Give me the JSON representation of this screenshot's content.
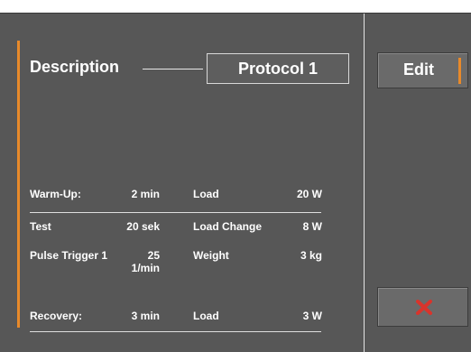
{
  "description": {
    "label": "Description",
    "protocol": "Protocol 1"
  },
  "rows": [
    {
      "label": "Warm-Up:",
      "value": "2 min",
      "param": "Load",
      "param_value": "20 W"
    },
    {
      "label": "Test",
      "value": "20 sek",
      "param": "Load Change",
      "param_value": "8 W"
    },
    {
      "label": "Pulse Trigger 1",
      "value": "25 1/min",
      "param": "Weight",
      "param_value": "3 kg"
    },
    {
      "label": "Recovery:",
      "value": "3 min",
      "param": "Load",
      "param_value": "3 W"
    }
  ],
  "buttons": {
    "edit": "Edit",
    "cancel_icon": "close-icon"
  },
  "colors": {
    "accent": "#e88a2a",
    "cancel_x": "#d8342c",
    "background": "#555555"
  }
}
